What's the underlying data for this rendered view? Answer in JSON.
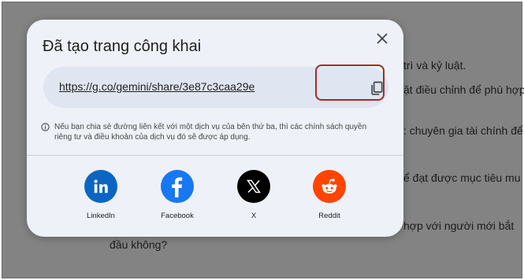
{
  "background": {
    "lines": [
      "trì và kỷ luật.",
      "ặt điều chỉnh để phù hợp",
      ": chuyên gia tài chính để",
      "ể đạt được mục tiêu mu",
      "hợp với người mới bắt",
      "đầu không?"
    ]
  },
  "dialog": {
    "title": "Đã tạo trang công khai",
    "link": "https://g.co/gemini/share/3e87c3caa29e",
    "notice": "Nếu bạn chia sẻ đường liên kết với một dịch vụ của bên thứ ba, thì các chính sách quyền riêng tư và điều khoản của dịch vụ đó sẽ được áp dụng.",
    "share_options": [
      {
        "label": "LinkedIn",
        "icon": "linkedin-icon",
        "color": "#0a66c2"
      },
      {
        "label": "Facebook",
        "icon": "facebook-icon",
        "color": "#1877f2"
      },
      {
        "label": "X",
        "icon": "x-icon",
        "color": "#000000"
      },
      {
        "label": "Reddit",
        "icon": "reddit-icon",
        "color": "#ff4500"
      }
    ]
  }
}
